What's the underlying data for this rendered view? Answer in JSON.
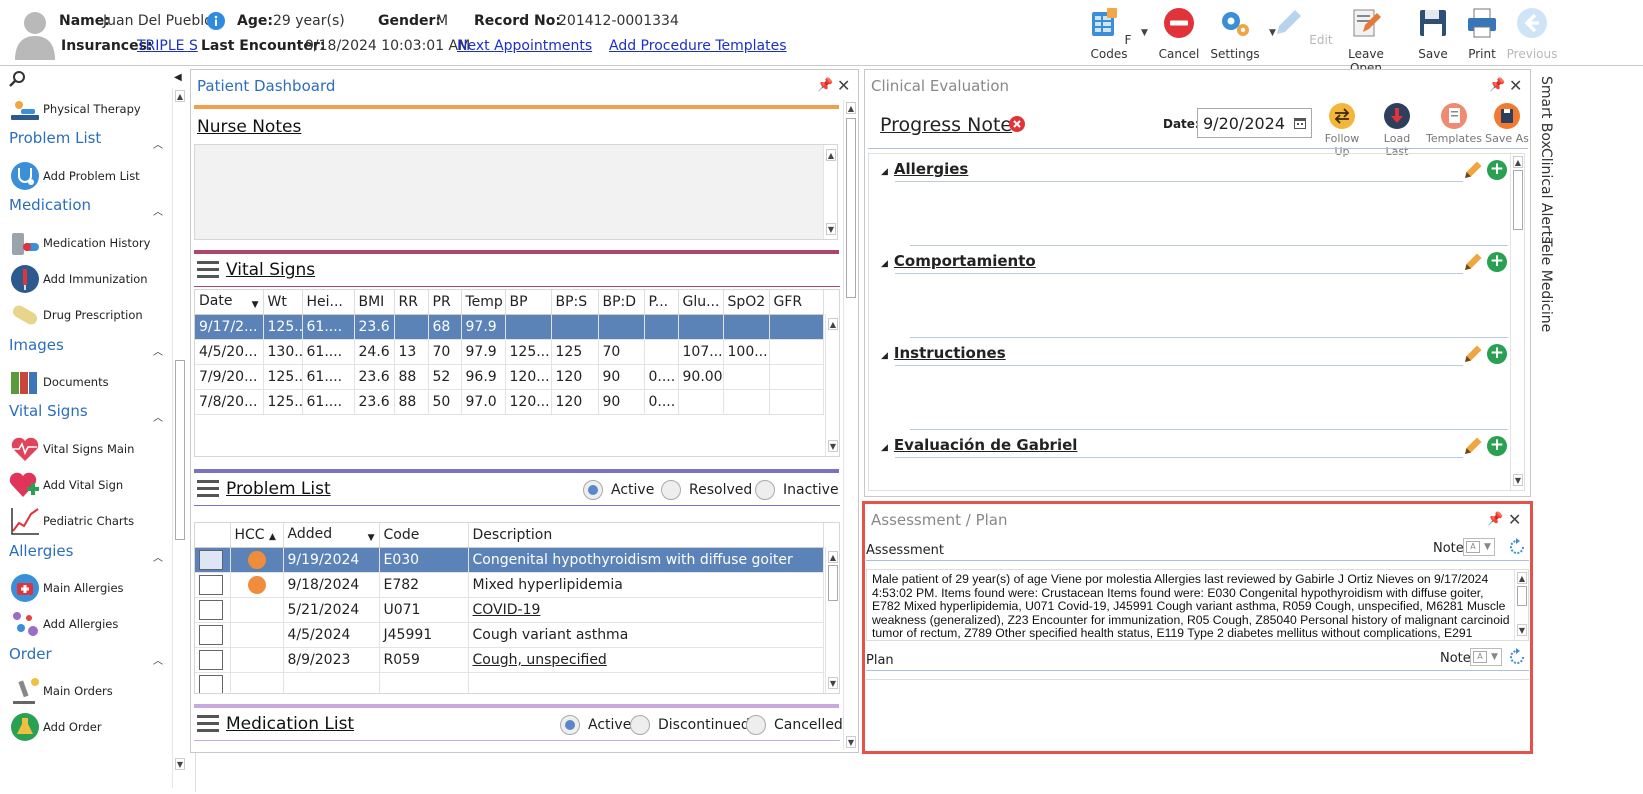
{
  "header": {
    "name_label": "Name:",
    "name_value": "Juan Del Pueblo",
    "age_label": "Age:",
    "age_value": "29 year(s)",
    "gender_label": "Gender:",
    "gender_value": "M",
    "record_label": "Record No:",
    "record_value": "201412-0001334",
    "insurances_label": "Insurances:",
    "insurances_value": "TRIPLE S",
    "last_encounter_label": "Last Encounter:",
    "last_encounter_value": "9/18/2024 10:03:01 AM",
    "next_appointments": "Next Appointments",
    "add_procedure_templates": "Add Procedure Templates"
  },
  "toolbar": {
    "fcodes": "F Codes",
    "cancel": "Cancel",
    "settings": "Settings",
    "edit": "Edit",
    "leave_open": "Leave Open",
    "save": "Save",
    "print": "Print",
    "previous": "Previous"
  },
  "sidebar": {
    "physical_therapy": "Physical Therapy",
    "problem_list": "Problem List",
    "add_problem_list": "Add Problem List",
    "medication": "Medication",
    "medication_history": "Medication History",
    "add_immunization": "Add Immunization",
    "drug_prescription": "Drug Prescription",
    "images": "Images",
    "documents": "Documents",
    "vital_signs": "Vital Signs",
    "vital_signs_main": "Vital Signs Main",
    "add_vital_sign": "Add Vital Sign",
    "pediatric_charts": "Pediatric Charts",
    "allergies": "Allergies",
    "main_allergies": "Main Allergies",
    "add_allergies": "Add Allergies",
    "order": "Order",
    "main_orders": "Main Orders",
    "add_order": "Add Order"
  },
  "dashboard": {
    "title": "Patient Dashboard",
    "nurse_notes": "Nurse Notes",
    "vital_signs": "Vital Signs",
    "vitals_columns": [
      "Date",
      "Wt",
      "Hei...",
      "BMI",
      "RR",
      "PR",
      "Temp",
      "BP",
      "BP:S",
      "BP:D",
      "P...",
      "Glu...",
      "SpO2",
      "GFR"
    ],
    "vitals_rows": [
      [
        "9/17/2...",
        "125...",
        "61....",
        "23.6",
        "",
        "68",
        "97.9",
        "",
        "",
        "",
        "",
        "",
        "",
        ""
      ],
      [
        "4/5/20...",
        "130...",
        "61....",
        "24.6",
        "13",
        "70",
        "97.9",
        "125....",
        "125",
        "70",
        "",
        "107....",
        "100....",
        ""
      ],
      [
        "7/9/20...",
        "125...",
        "61....",
        "23.6",
        "88",
        "52",
        "96.9",
        "120....",
        "120",
        "90",
        "0....",
        "90.00",
        "",
        ""
      ],
      [
        "7/8/20...",
        "125...",
        "61....",
        "23.6",
        "88",
        "50",
        "97.0",
        "120....",
        "120",
        "90",
        "0....",
        "",
        "",
        ""
      ]
    ],
    "problem_list": "Problem List",
    "problem_filters": [
      "Active",
      "Resolved",
      "Inactive"
    ],
    "problem_columns": [
      "",
      "HCC",
      "Added",
      "Code",
      "Description"
    ],
    "problem_rows": [
      {
        "hcc": true,
        "added": "9/19/2024",
        "code": "E030",
        "desc": "Congenital hypothyroidism with diffuse goiter"
      },
      {
        "hcc": true,
        "added": "9/18/2024",
        "code": "E782",
        "desc": "Mixed hyperlipidemia"
      },
      {
        "hcc": false,
        "added": "5/21/2024",
        "code": "U071",
        "desc": "COVID-19"
      },
      {
        "hcc": false,
        "added": "4/5/2024",
        "code": "J45991",
        "desc": "Cough variant asthma"
      },
      {
        "hcc": false,
        "added": "8/9/2023",
        "code": "R059",
        "desc": "Cough, unspecified"
      }
    ],
    "medication_list": "Medication List",
    "medication_filters": [
      "Active",
      "Discontinued",
      "Cancelled"
    ]
  },
  "clinical": {
    "title": "Clinical Evaluation",
    "progress_note": "Progress Note",
    "date_label": "Date:",
    "date_value": "9/20/2024",
    "actions": [
      "Follow Up",
      "Load Last",
      "Templates",
      "Save As"
    ],
    "sections": [
      "Allergies",
      "Comportamiento",
      "Instructiones",
      "Evaluación de Gabriel"
    ]
  },
  "assessment": {
    "title": "Assessment / Plan",
    "assessment_label": "Assessment",
    "note_label": "Note",
    "assessment_text": "Male patient of 29 year(s) of age Viene por molestia     Allergies last reviewed by Gabirle J Ortiz Nieves on 9/17/2024 4:53:02 PM.    Items found were:  Crustacean  Items found were:  E030 Congenital hypothyroidism with diffuse goiter, E782 Mixed hyperlipidemia, U071 Covid-19, J45991 Cough variant asthma, R059 Cough, unspecified, M6281 Muscle weakness (generalized), Z23 Encounter for immunization, R05 Cough, Z85040 Personal history of malignant carcinoid tumor of rectum, Z789 Other specified health status, E119 Type 2 diabetes mellitus without complications, E291",
    "plan_label": "Plan"
  },
  "right_tabs": [
    "Smart Box",
    "Clinical Alerts",
    "Tele Medicine"
  ],
  "colors": {
    "accent_blue": "#2a6ebf",
    "selected_row": "#5b83b8",
    "hcc_orange": "#ef8d3c",
    "nurse_band": "#f0a04b",
    "vitals_band": "#b0456a",
    "problem_band": "#7b72c2",
    "medication_band": "#c9a8e0",
    "highlight_border": "#e4524a"
  }
}
